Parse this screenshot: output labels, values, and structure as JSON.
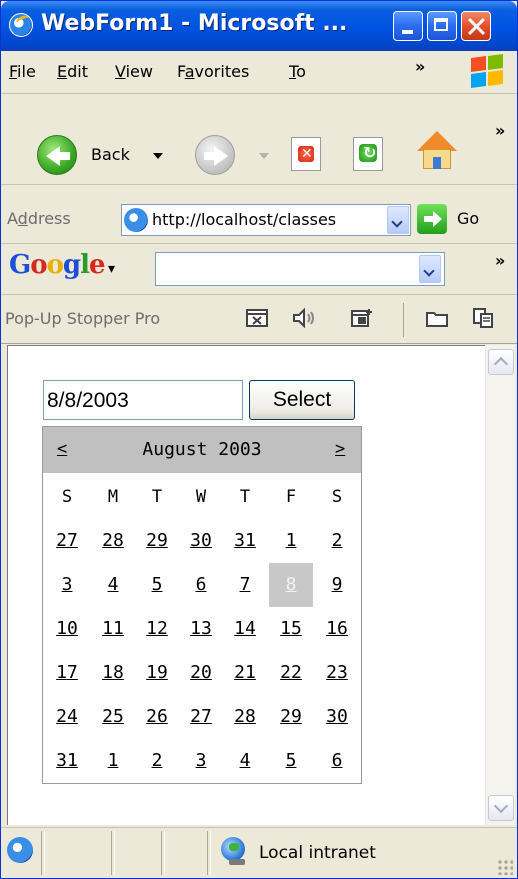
{
  "window": {
    "title": "WebForm1 - Microsoft ..."
  },
  "menu": {
    "items": [
      {
        "ul": "F",
        "rest": "ile"
      },
      {
        "ul": "E",
        "rest": "dit"
      },
      {
        "ul": "V",
        "rest": "iew"
      },
      {
        "pre": "F",
        "ul": "a",
        "rest": "vorites"
      },
      {
        "ul": "T",
        "rest": "o"
      }
    ],
    "overflow": "»"
  },
  "toolbar": {
    "back_label": "Back",
    "overflow": "»"
  },
  "address": {
    "label": "Address",
    "url": "http://localhost/classes",
    "go_label": "Go"
  },
  "google": {
    "logo": "Google",
    "query": "",
    "overflow": "»"
  },
  "popup": {
    "label": "Pop-Up Stopper Pro"
  },
  "form": {
    "date_value": "8/8/2003",
    "select_label": "Select"
  },
  "calendar": {
    "prev": "<",
    "next": ">",
    "title": "August 2003",
    "dow": [
      "S",
      "M",
      "T",
      "W",
      "T",
      "F",
      "S"
    ],
    "weeks": [
      [
        "27",
        "28",
        "29",
        "30",
        "31",
        "1",
        "2"
      ],
      [
        "3",
        "4",
        "5",
        "6",
        "7",
        "8",
        "9"
      ],
      [
        "10",
        "11",
        "12",
        "13",
        "14",
        "15",
        "16"
      ],
      [
        "17",
        "18",
        "19",
        "20",
        "21",
        "22",
        "23"
      ],
      [
        "24",
        "25",
        "26",
        "27",
        "28",
        "29",
        "30"
      ],
      [
        "31",
        "1",
        "2",
        "3",
        "4",
        "5",
        "6"
      ]
    ],
    "selected": "8"
  },
  "status": {
    "zone": "Local intranet"
  },
  "colors": {
    "titlebar": "#0054e3",
    "chrome": "#ece9d8",
    "calendar_header": "#c0c0c0",
    "selected_day": "#c8c8c8"
  },
  "icons": [
    "ie-icon",
    "minimize-icon",
    "maximize-icon",
    "close-icon",
    "windows-logo-icon",
    "back-icon",
    "forward-icon",
    "stop-icon",
    "refresh-icon",
    "home-icon",
    "go-icon",
    "globe-icon"
  ]
}
